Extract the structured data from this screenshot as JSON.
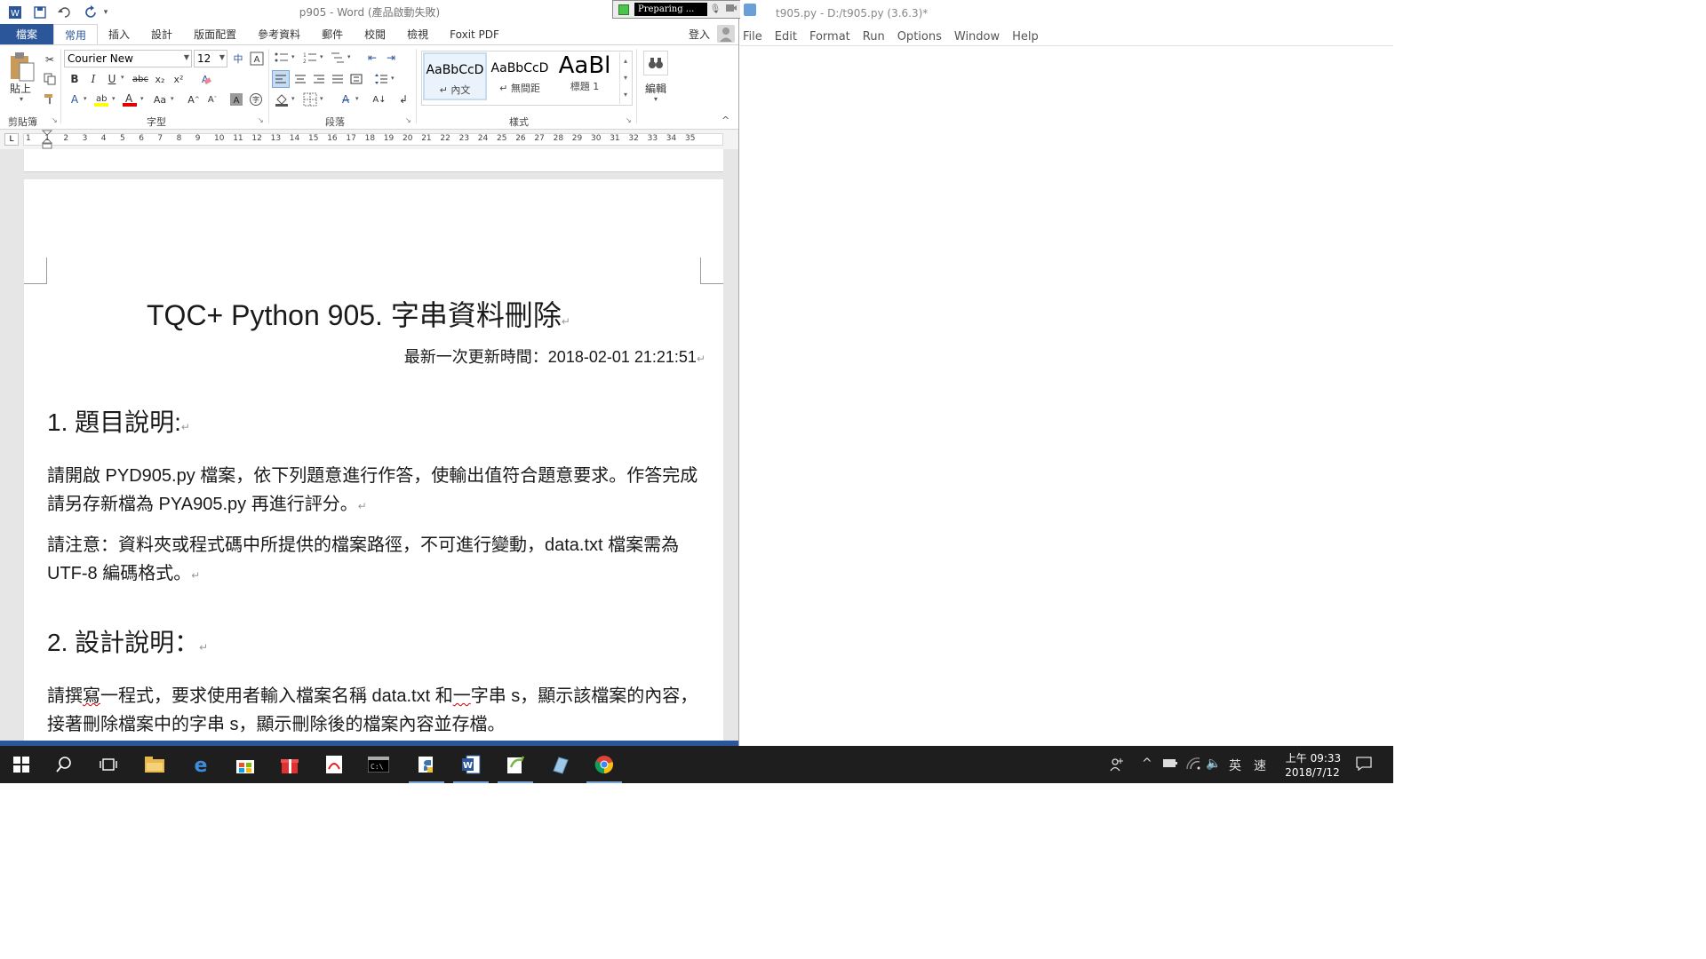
{
  "word": {
    "title": "p905 - Word (產品啟動失敗)",
    "tabs": [
      {
        "label": "檔案"
      },
      {
        "label": "常用"
      },
      {
        "label": "插入"
      },
      {
        "label": "設計"
      },
      {
        "label": "版面配置"
      },
      {
        "label": "參考資料"
      },
      {
        "label": "郵件"
      },
      {
        "label": "校閱"
      },
      {
        "label": "檢視"
      },
      {
        "label": "Foxit PDF"
      }
    ],
    "signin": "登入",
    "ribbon": {
      "paste_label": "貼上",
      "font_name": "Courier New",
      "font_size": "12",
      "styles": [
        {
          "sample": "AaBbCcD",
          "name": "↵ 內文"
        },
        {
          "sample": "AaBbCcD",
          "name": "↵ 無間距"
        },
        {
          "sample": "AaBl",
          "name": "標題 1"
        }
      ],
      "edit_label": "編輯",
      "groups": {
        "clipboard": "剪貼簿",
        "font": "字型",
        "paragraph": "段落",
        "styles": "樣式"
      }
    },
    "ruler_numbers": [
      "1",
      "1",
      "2",
      "3",
      "4",
      "5",
      "6",
      "7",
      "8",
      "9",
      "10",
      "11",
      "12",
      "13",
      "14",
      "15",
      "16",
      "17",
      "18",
      "19",
      "20",
      "21",
      "22",
      "23",
      "24",
      "25",
      "26",
      "27",
      "28",
      "29",
      "30",
      "31",
      "32",
      "33",
      "34",
      "35"
    ],
    "document": {
      "title": "TQC+ Python 905.  字串資料刪除",
      "updated": "最新一次更新時間：2018-02-01 21:21:51",
      "section1_heading": "1.  題目說明:",
      "section1_para1": "請開啟 PYD905.py 檔案，依下列題意進行作答，使輸出值符合題意要求。作答完成請另存新檔為 PYA905.py 再進行評分。",
      "section1_para2": "請注意：資料夾或程式碼中所提供的檔案路徑，不可進行變動，data.txt 檔案需為 UTF-8 編碼格式。",
      "section2_heading": "2.  設計說明：",
      "section2_para1_a": "請撰",
      "section2_para1_b": "寫",
      "section2_para1_c": "一程式，要求使用者輸入檔案名稱 data.txt 和",
      "section2_para1_d": "一",
      "section2_para1_e": "字串 s，顯示該檔案的內容，接著刪除檔案中的字串 s，顯示刪除後的檔案內容並存檔。"
    }
  },
  "recorder": {
    "status": "Preparing ..."
  },
  "idle": {
    "title": "t905.py - D:/t905.py (3.6.3)*",
    "menus": [
      "File",
      "Edit",
      "Format",
      "Run",
      "Options",
      "Window",
      "Help"
    ]
  },
  "taskbar": {
    "ime": "英",
    "ime2": "速",
    "time": "上午 09:33",
    "date": "2018/7/12"
  }
}
